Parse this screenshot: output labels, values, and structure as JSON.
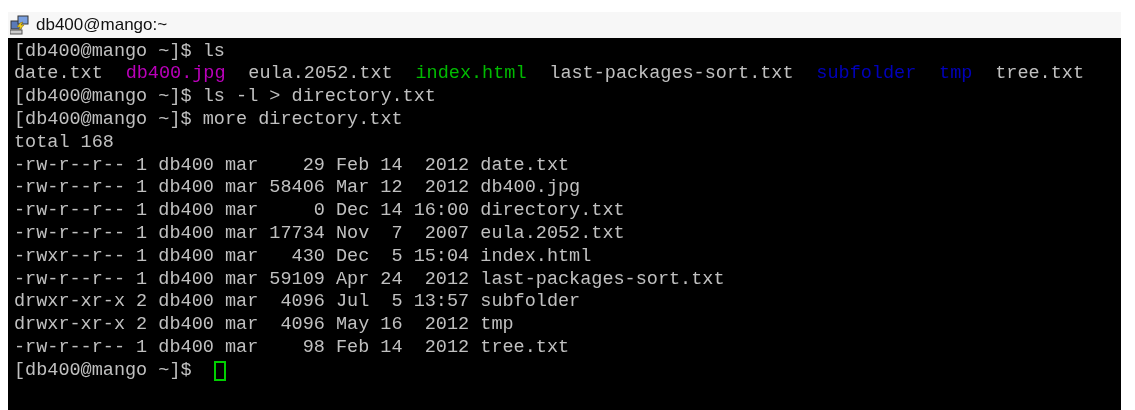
{
  "window": {
    "title": "db400@mango:~"
  },
  "terminal": {
    "lines": [
      {
        "kind": "command",
        "prompt": "[db400@mango ~]$",
        "command": "ls"
      },
      {
        "kind": "listing",
        "entries": [
          {
            "name": "date.txt",
            "color": "#c0c0c0"
          },
          {
            "name": "db400.jpg",
            "color": "#bb00bb"
          },
          {
            "name": "eula.2052.txt",
            "color": "#c0c0c0"
          },
          {
            "name": "index.html",
            "color": "#00bb00"
          },
          {
            "name": "last-packages-sort.txt",
            "color": "#c0c0c0"
          },
          {
            "name": "subfolder",
            "color": "#0000bb"
          },
          {
            "name": "tmp",
            "color": "#0000bb"
          },
          {
            "name": "tree.txt",
            "color": "#c0c0c0"
          }
        ]
      },
      {
        "kind": "command",
        "prompt": "[db400@mango ~]$",
        "command": "ls -l > directory.txt"
      },
      {
        "kind": "command",
        "prompt": "[db400@mango ~]$",
        "command": "more directory.txt"
      },
      {
        "kind": "text",
        "text": "total 168"
      },
      {
        "kind": "text",
        "text": "-rw-r--r-- 1 db400 mar    29 Feb 14  2012 date.txt"
      },
      {
        "kind": "text",
        "text": "-rw-r--r-- 1 db400 mar 58406 Mar 12  2012 db400.jpg"
      },
      {
        "kind": "text",
        "text": "-rw-r--r-- 1 db400 mar     0 Dec 14 16:00 directory.txt"
      },
      {
        "kind": "text",
        "text": "-rw-r--r-- 1 db400 mar 17734 Nov  7  2007 eula.2052.txt"
      },
      {
        "kind": "text",
        "text": "-rwxr--r-- 1 db400 mar   430 Dec  5 15:04 index.html"
      },
      {
        "kind": "text",
        "text": "-rw-r--r-- 1 db400 mar 59109 Apr 24  2012 last-packages-sort.txt"
      },
      {
        "kind": "text",
        "text": "drwxr-xr-x 2 db400 mar  4096 Jul  5 13:57 subfolder"
      },
      {
        "kind": "text",
        "text": "drwxr-xr-x 2 db400 mar  4096 May 16  2012 tmp"
      },
      {
        "kind": "text",
        "text": "-rw-r--r-- 1 db400 mar    98 Feb 14  2012 tree.txt"
      },
      {
        "kind": "command",
        "prompt": "[db400@mango ~]$",
        "cursor": true
      }
    ]
  }
}
